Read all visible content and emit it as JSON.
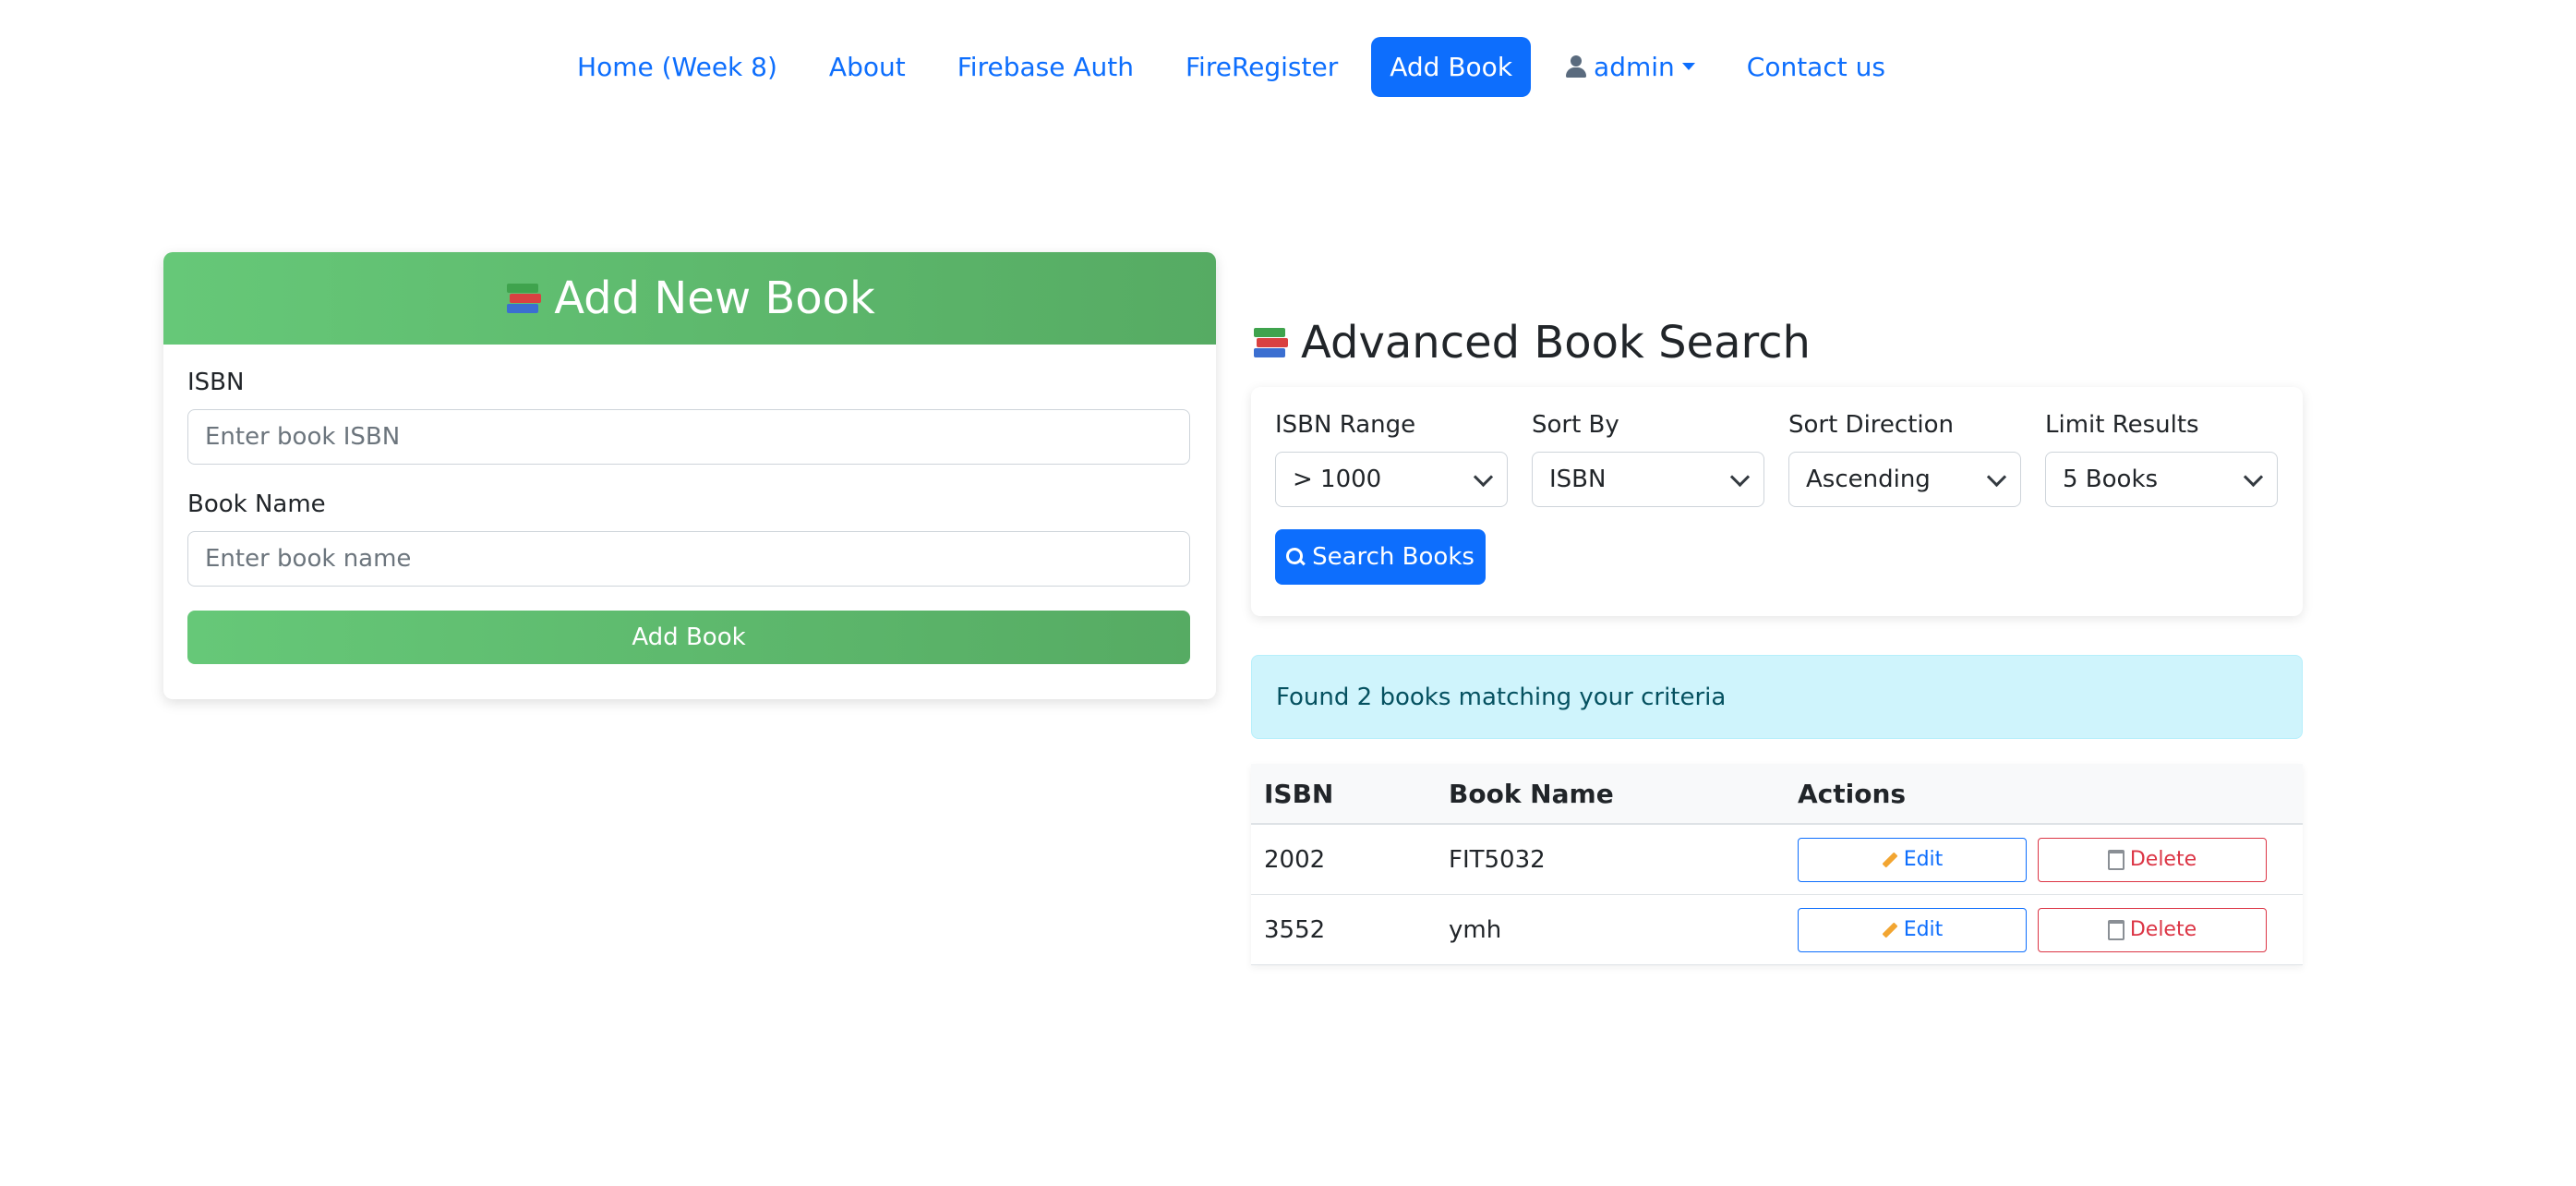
{
  "nav": {
    "items": [
      {
        "label": "Home (Week 8)"
      },
      {
        "label": "About"
      },
      {
        "label": "Firebase Auth"
      },
      {
        "label": "FireRegister"
      },
      {
        "label": "Add Book",
        "active": true
      },
      {
        "label": "admin",
        "dropdown": true
      },
      {
        "label": "Contact us"
      }
    ]
  },
  "add_form": {
    "title": "Add New Book",
    "isbn_label": "ISBN",
    "isbn_placeholder": "Enter book ISBN",
    "isbn_value": "",
    "name_label": "Book Name",
    "name_placeholder": "Enter book name",
    "name_value": "",
    "submit_label": "Add Book"
  },
  "search": {
    "title": "Advanced Book Search",
    "filters": [
      {
        "label": "ISBN Range",
        "value": "> 1000"
      },
      {
        "label": "Sort By",
        "value": "ISBN"
      },
      {
        "label": "Sort Direction",
        "value": "Ascending"
      },
      {
        "label": "Limit Results",
        "value": "5 Books"
      }
    ],
    "button_label": "Search Books",
    "result_text": "Found 2 books matching your criteria"
  },
  "table": {
    "headers": [
      "ISBN",
      "Book Name",
      "Actions"
    ],
    "rows": [
      {
        "isbn": "2002",
        "name": "FIT5032"
      },
      {
        "isbn": "3552",
        "name": "ymh"
      }
    ],
    "edit_label": "Edit",
    "delete_label": "Delete"
  },
  "colors": {
    "primary": "#0d6efd",
    "success_gradient_start": "#66c878",
    "success_gradient_end": "#56ab63",
    "danger": "#dc3545",
    "info_bg": "#cff4fc"
  }
}
